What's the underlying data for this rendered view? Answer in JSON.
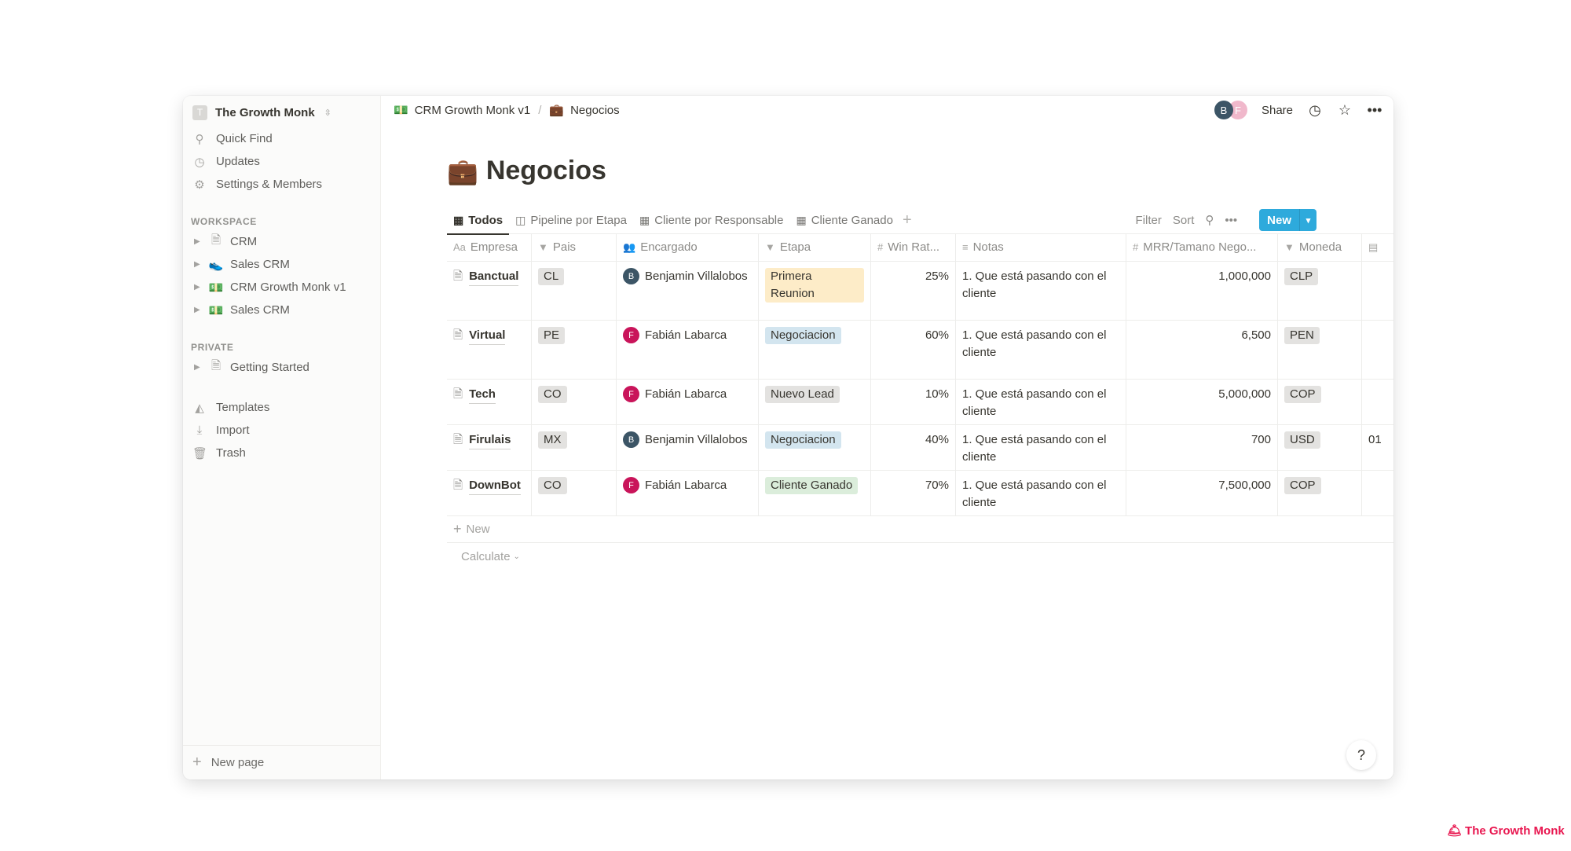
{
  "sidebar": {
    "workspace_name": "The Growth Monk",
    "workspace_initial": "T",
    "nav": [
      {
        "label": "Quick Find",
        "icon": "search-icon",
        "glyph": "⚲"
      },
      {
        "label": "Updates",
        "icon": "clock-icon",
        "glyph": "◷"
      },
      {
        "label": "Settings & Members",
        "icon": "gear-icon",
        "glyph": "⚙"
      }
    ],
    "workspace_label": "WORKSPACE",
    "workspace_items": [
      {
        "label": "CRM",
        "icon": "page-icon",
        "glyph": "🗎"
      },
      {
        "label": "Sales CRM",
        "icon": "shoe-icon",
        "glyph": "👟"
      },
      {
        "label": "CRM Growth Monk v1",
        "icon": "money-icon",
        "glyph": "💵"
      },
      {
        "label": "Sales CRM",
        "icon": "money-icon",
        "glyph": "💵"
      }
    ],
    "private_label": "PRIVATE",
    "private_items": [
      {
        "label": "Getting Started",
        "icon": "page-icon",
        "glyph": "🗎"
      }
    ],
    "bottom_nav": [
      {
        "label": "Templates",
        "icon": "templates-icon",
        "glyph": "◭"
      },
      {
        "label": "Import",
        "icon": "download-icon",
        "glyph": "⤓"
      },
      {
        "label": "Trash",
        "icon": "trash-icon",
        "glyph": "🗑"
      }
    ],
    "new_page_label": "New page"
  },
  "topbar": {
    "breadcrumb": [
      {
        "label": "CRM Growth Monk v1",
        "glyph": "💵"
      },
      {
        "label": "Negocios",
        "glyph": "💼"
      }
    ],
    "separator": "/",
    "avatars": [
      "B",
      "F"
    ],
    "share_label": "Share"
  },
  "page": {
    "title": "Negocios",
    "title_emoji": "💼",
    "views": [
      {
        "label": "Todos",
        "icon": "table-icon",
        "glyph": "▦",
        "active": true
      },
      {
        "label": "Pipeline por Etapa",
        "icon": "board-icon",
        "glyph": "◫",
        "active": false
      },
      {
        "label": "Cliente por Responsable",
        "icon": "table-icon",
        "glyph": "▦",
        "active": false
      },
      {
        "label": "Cliente Ganado",
        "icon": "table-icon",
        "glyph": "▦",
        "active": false
      }
    ],
    "tools": {
      "filter": "Filter",
      "sort": "Sort",
      "new": "New"
    }
  },
  "table": {
    "columns": [
      {
        "label": "Empresa",
        "glyph": "Aa"
      },
      {
        "label": "Pais",
        "glyph": "▼"
      },
      {
        "label": "Encargado",
        "glyph": "👥"
      },
      {
        "label": "Etapa",
        "glyph": "▼"
      },
      {
        "label": "Win Rat...",
        "glyph": "#"
      },
      {
        "label": "Notas",
        "glyph": "≡"
      },
      {
        "label": "MRR/Tamano Nego...",
        "glyph": "#"
      },
      {
        "label": "Moneda",
        "glyph": "▼"
      },
      {
        "label": "",
        "glyph": "▤"
      }
    ],
    "rows": [
      {
        "empresa": "Banctual",
        "pais": "CL",
        "encargado": "Benjamin Villalobos",
        "initial": "B",
        "avatar_color": "#3c5566",
        "etapa": "Primera Reunion",
        "etapa_bg": "#fdecc8",
        "win_rate": "25%",
        "notas": "1. Que está pasando con el cliente",
        "mrr": "1,000,000",
        "moneda": "CLP",
        "extra": ""
      },
      {
        "empresa": "Virtual",
        "pais": "PE",
        "encargado": "Fabián Labarca",
        "initial": "F",
        "avatar_color": "#c9145a",
        "etapa": "Negociacion",
        "etapa_bg": "#d3e5ef",
        "win_rate": "60%",
        "notas": "1. Que está pasando con el cliente",
        "mrr": "6,500",
        "moneda": "PEN",
        "extra": ""
      },
      {
        "empresa": "Tech",
        "pais": "CO",
        "encargado": "Fabián Labarca",
        "initial": "F",
        "avatar_color": "#c9145a",
        "etapa": "Nuevo Lead",
        "etapa_bg": "#e3e2e0",
        "win_rate": "10%",
        "notas": "1. Que está pasando con el cliente",
        "mrr": "5,000,000",
        "moneda": "COP",
        "extra": ""
      },
      {
        "empresa": "Firulais",
        "pais": "MX",
        "encargado": "Benjamin Villalobos",
        "initial": "B",
        "avatar_color": "#3c5566",
        "etapa": "Negociacion",
        "etapa_bg": "#d3e5ef",
        "win_rate": "40%",
        "notas": "1. Que está pasando con el cliente",
        "mrr": "700",
        "moneda": "USD",
        "extra": "01"
      },
      {
        "empresa": "DownBot",
        "pais": "CO",
        "encargado": "Fabián Labarca",
        "initial": "F",
        "avatar_color": "#c9145a",
        "etapa": "Cliente Ganado",
        "etapa_bg": "#dbeddb",
        "win_rate": "70%",
        "notas": "1. Que está pasando con el cliente",
        "mrr": "7,500,000",
        "moneda": "COP",
        "extra": ""
      }
    ],
    "new_row_label": "New",
    "calculate_label": "Calculate"
  },
  "help_label": "?",
  "brand": {
    "label": "The Growth Monk",
    "glyph": "🛎",
    "color": "#e8164f"
  }
}
